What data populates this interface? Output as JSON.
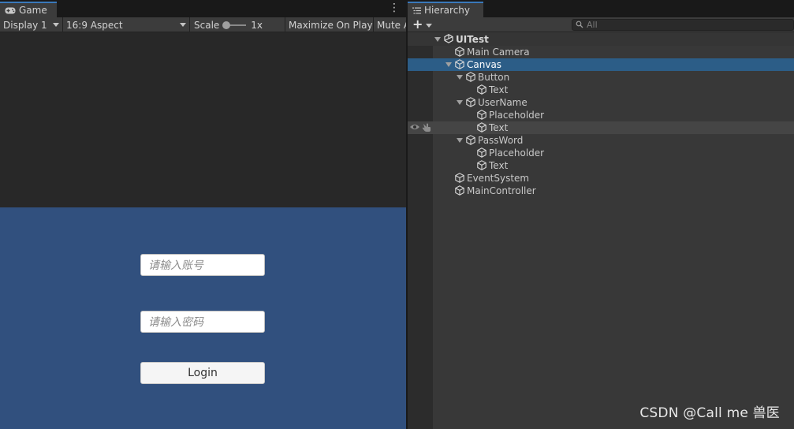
{
  "game": {
    "tab_label": "Game",
    "toolbar": {
      "display": "Display 1",
      "aspect": "16:9 Aspect",
      "scale_label": "Scale",
      "scale_value": "1x",
      "scale_fraction": 0,
      "maximize": "Maximize On Play",
      "mute": "Mute A"
    },
    "ui": {
      "username_placeholder": "请输入账号",
      "password_placeholder": "请输入密码",
      "login_label": "Login"
    },
    "colors": {
      "canvas_bg": "#31507e",
      "viewport_bg": "#282828"
    }
  },
  "hierarchy": {
    "tab_label": "Hierarchy",
    "search_placeholder": "All",
    "rows": [
      {
        "label": "UITest",
        "depth": 0,
        "type": "scene",
        "expanded": true
      },
      {
        "label": "Main Camera",
        "depth": 1,
        "type": "object"
      },
      {
        "label": "Canvas",
        "depth": 1,
        "type": "object",
        "expanded": true,
        "selected": true
      },
      {
        "label": "Button",
        "depth": 2,
        "type": "object",
        "expanded": true
      },
      {
        "label": "Text",
        "depth": 3,
        "type": "object"
      },
      {
        "label": "UserName",
        "depth": 2,
        "type": "object",
        "expanded": true
      },
      {
        "label": "Placeholder",
        "depth": 3,
        "type": "object"
      },
      {
        "label": "Text",
        "depth": 3,
        "type": "object",
        "hover": true
      },
      {
        "label": "PassWord",
        "depth": 2,
        "type": "object",
        "expanded": true
      },
      {
        "label": "Placeholder",
        "depth": 3,
        "type": "object"
      },
      {
        "label": "Text",
        "depth": 3,
        "type": "object"
      },
      {
        "label": "EventSystem",
        "depth": 1,
        "type": "object"
      },
      {
        "label": "MainController",
        "depth": 1,
        "type": "object"
      }
    ],
    "colors": {
      "selected": "#2c5d87"
    }
  },
  "watermark": "CSDN @Call me 兽医"
}
